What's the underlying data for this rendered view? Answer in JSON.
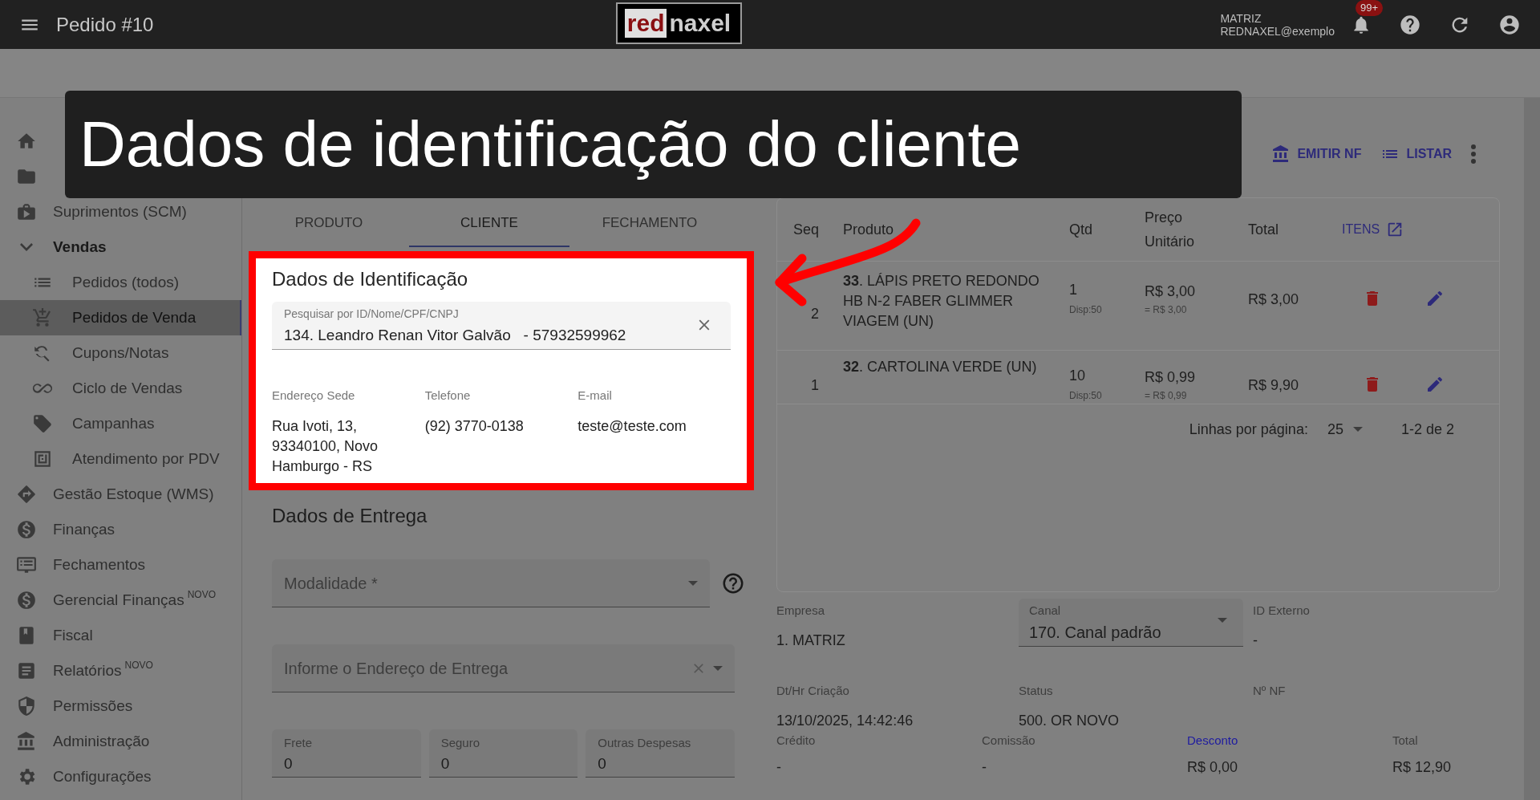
{
  "topbar": {
    "title": "Pedido #10",
    "logo": [
      "red",
      "naxel"
    ],
    "company": "MATRIZ",
    "user": "REDNAXEL@exemplo",
    "notifications": "99+"
  },
  "caption": "Dados de identificação do cliente",
  "sidebar": {
    "items": [
      {
        "label": "Suprimentos (SCM)"
      },
      {
        "label": "Vendas",
        "expanded": true,
        "children": [
          {
            "label": "Pedidos (todos)",
            "selected": false
          },
          {
            "label": "Pedidos de Venda",
            "selected": true
          },
          {
            "label": "Cupons/Notas",
            "selected": false
          },
          {
            "label": "Ciclo de Vendas",
            "selected": false
          },
          {
            "label": "Campanhas",
            "selected": false
          },
          {
            "label": "Atendimento por PDV",
            "selected": false
          }
        ]
      },
      {
        "label": "Gestão Estoque (WMS)"
      },
      {
        "label": "Finanças"
      },
      {
        "label": "Fechamentos"
      },
      {
        "label": "Gerencial Finanças",
        "badge": "NOVO"
      },
      {
        "label": "Fiscal"
      },
      {
        "label": "Relatórios",
        "badge": "NOVO"
      },
      {
        "label": "Permissões"
      },
      {
        "label": "Administração"
      },
      {
        "label": "Configurações"
      }
    ]
  },
  "toolbar": [
    "EMITIR NF",
    "LISTAR"
  ],
  "tabs": [
    {
      "label": "PRODUTO",
      "selected": false
    },
    {
      "label": "CLIENTE",
      "selected": true
    },
    {
      "label": "FECHAMENTO",
      "selected": false
    }
  ],
  "identification": {
    "title": "Dados de Identificação",
    "search": {
      "label": "Pesquisar por ID/Nome/CPF/CNPJ",
      "value": "134. Leandro Renan Vitor Galvão   - 57932599962"
    },
    "info": [
      {
        "label": "Endereço Sede",
        "value": "Rua Ivoti, 13, 93340100, Novo Hamburgo - RS"
      },
      {
        "label": "Telefone",
        "value": "(92) 3770-0138"
      },
      {
        "label": "E-mail",
        "value": "teste@teste.com"
      }
    ]
  },
  "delivery": {
    "title": "Dados de Entrega",
    "modality": {
      "placeholder": "Modalidade *"
    },
    "address": {
      "placeholder": "Informe o Endereço de Entrega"
    },
    "costs": [
      {
        "label": "Frete",
        "value": "0"
      },
      {
        "label": "Seguro",
        "value": "0"
      },
      {
        "label": "Outras Despesas",
        "value": "0"
      }
    ]
  },
  "table": {
    "columns": [
      "Seq",
      "Produto",
      "Qtd",
      "Preço Unitário",
      "Total"
    ],
    "items_link": "ITENS",
    "rows": [
      {
        "seq": "2",
        "product": "**33**. LÁPIS PRETO REDONDO HB N-2 FABER GLIMMER VIAGEM (UN)",
        "qty": "1",
        "stock": "Disp:50",
        "price": "R$ 3,00",
        "price_note": "= R$ 3,00",
        "total": "R$ 3,00"
      },
      {
        "seq": "1",
        "product": "**32**. CARTOLINA VERDE (UN)",
        "qty": "10",
        "stock": "Disp:50",
        "price": "R$ 0,99",
        "price_note": "= R$ 0,99",
        "total": "R$ 9,90"
      }
    ],
    "pagination": {
      "label": "Linhas por página:",
      "per_page": "25",
      "range": "1-2 de 2"
    }
  },
  "summary": [
    {
      "kind": "plain",
      "label": "Empresa",
      "value": "1. MATRIZ"
    },
    {
      "kind": "select",
      "label": "Canal",
      "value": "170. Canal padrão"
    },
    {
      "kind": "plain",
      "label": "ID Externo",
      "value": "-"
    },
    {
      "kind": "plain",
      "label": "Dt/Hr Criação",
      "value": "13/10/2025, 14:42:46"
    },
    {
      "kind": "plain",
      "label": "Status",
      "value": "500. OR NOVO"
    },
    {
      "kind": "plain",
      "label": "Nº NF"
    }
  ],
  "totals": [
    {
      "kind": "plain",
      "label": "Crédito",
      "value": "-"
    },
    {
      "kind": "plain",
      "label": "Comissão",
      "value": "-"
    },
    {
      "kind": "link",
      "label": "Desconto",
      "value": "R$ 0,00"
    },
    {
      "kind": "plain",
      "label": "Total",
      "value": "R$ 12,90"
    }
  ]
}
